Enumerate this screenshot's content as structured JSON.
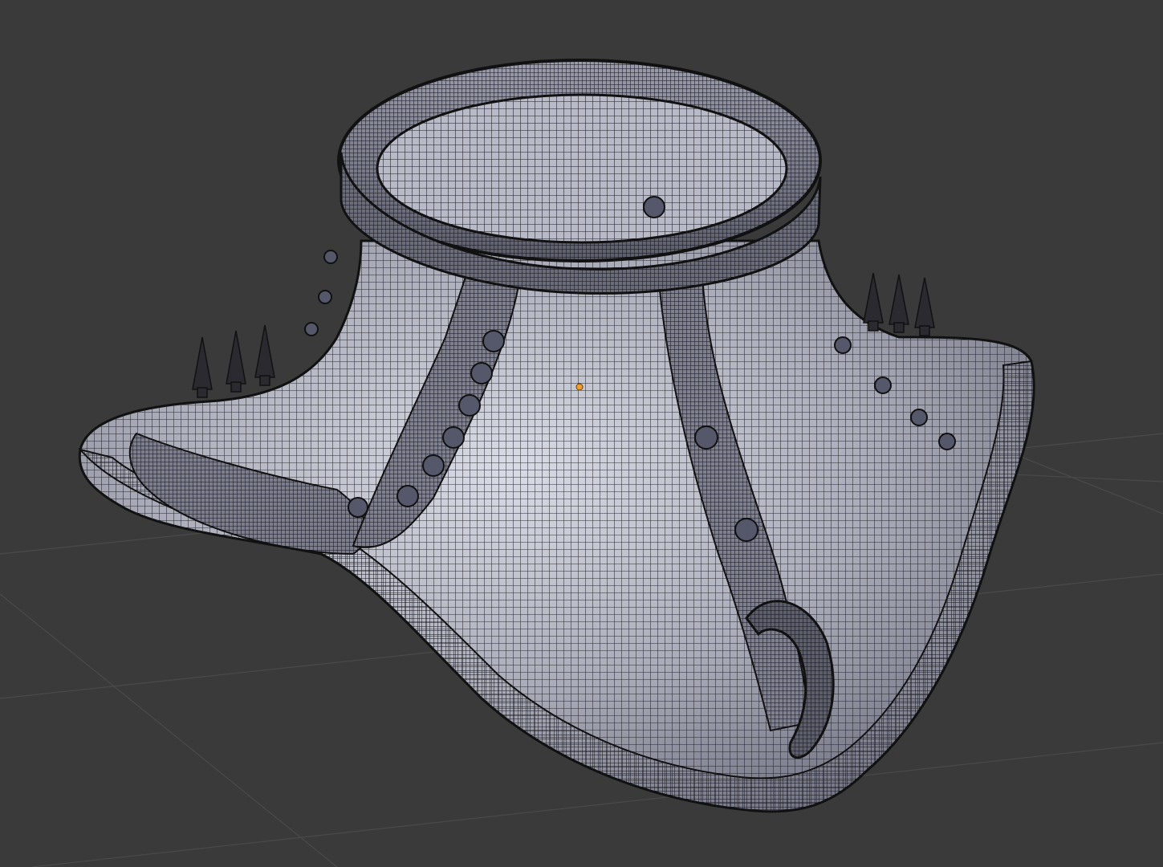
{
  "app": {
    "name": "3D Viewport"
  },
  "viewport": {
    "background_color": "#3a3a3a",
    "grid_color": "#4a4a4a",
    "grid_visible": true,
    "shading": "solid-with-wireframe-overlay",
    "mesh_color": "#a9abb8",
    "mesh_highlight_color": "#d9dbe6",
    "wire_color": "#1a1a1e",
    "origin_color": "#f0a030"
  },
  "object": {
    "type": "mesh",
    "description_icon": "gorget-collar-mesh",
    "parts": [
      "neck-ring",
      "collar-flare",
      "vertical-straps",
      "rivets",
      "spikes-left",
      "spikes-right",
      "hook-ornament"
    ]
  }
}
